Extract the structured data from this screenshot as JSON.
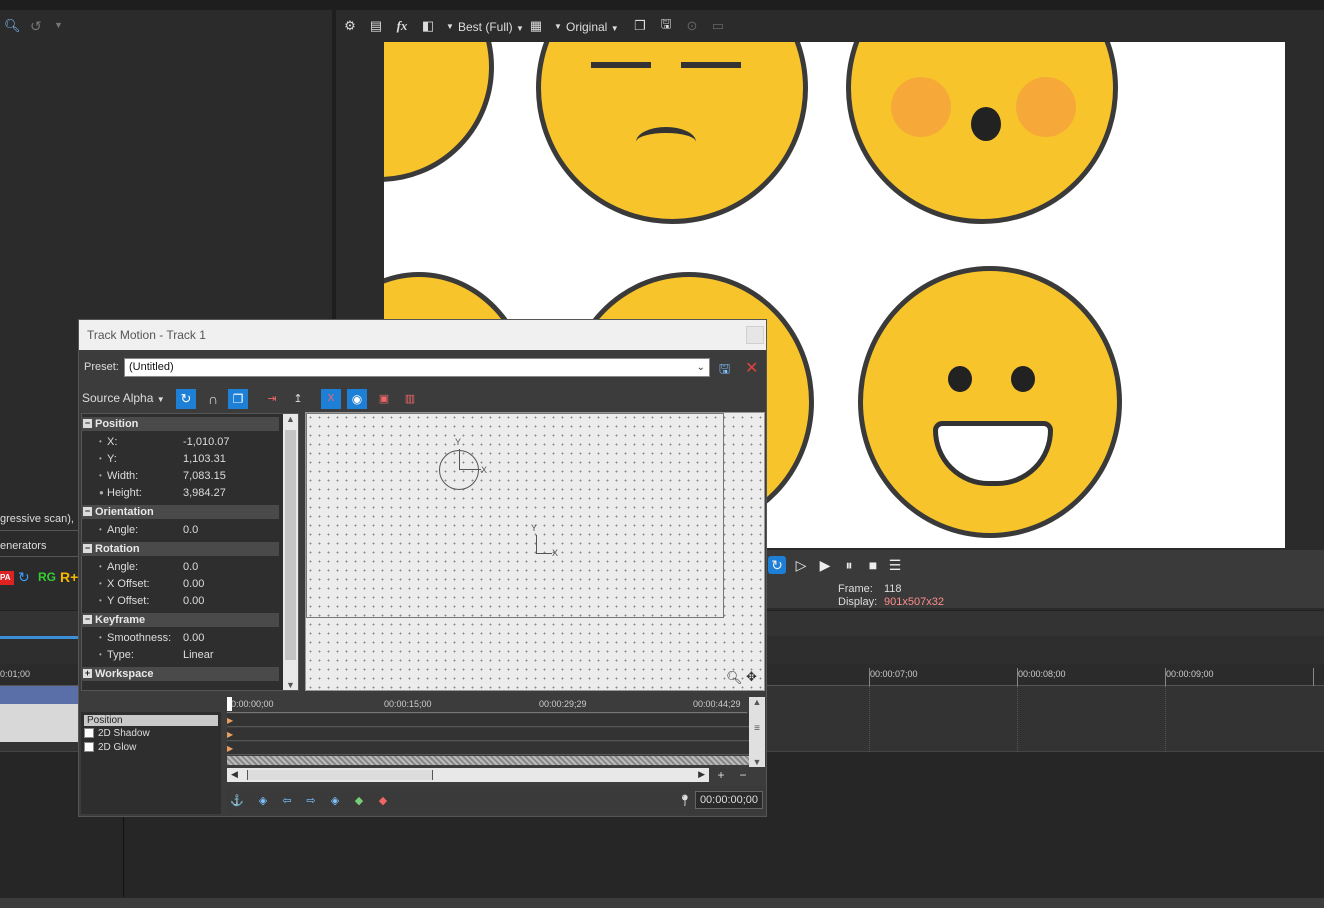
{
  "toolbar": {
    "quality": "Best (Full)",
    "size_mode": "Original"
  },
  "left_panel": {
    "media_info": "gressive scan),",
    "generators": "enerators",
    "ruler_time": "0:01;00"
  },
  "preview": {
    "frame_label": "Frame:",
    "frame_value": "118",
    "display_label": "Display:",
    "display_value": "901x507x32"
  },
  "timeline_ruler": [
    "00:00:07;00",
    "00:00:08;00",
    "00:00:09;00"
  ],
  "dialog": {
    "title": "Track Motion - Track 1",
    "preset_label": "Preset:",
    "preset_value": "(Untitled)",
    "source_alpha": "Source Alpha",
    "sections": {
      "position": {
        "label": "Position",
        "x_label": "X:",
        "x_value": "-1,010.07",
        "y_label": "Y:",
        "y_value": "1,103.31",
        "width_label": "Width:",
        "width_value": "7,083.15",
        "height_label": "Height:",
        "height_value": "3,984.27"
      },
      "orientation": {
        "label": "Orientation",
        "angle_label": "Angle:",
        "angle_value": "0.0"
      },
      "rotation": {
        "label": "Rotation",
        "angle_label": "Angle:",
        "angle_value": "0.0",
        "xoff_label": "X Offset:",
        "xoff_value": "0.00",
        "yoff_label": "Y Offset:",
        "yoff_value": "0.00"
      },
      "keyframe": {
        "label": "Keyframe",
        "smooth_label": "Smoothness:",
        "smooth_value": "0.00",
        "type_label": "Type:",
        "type_value": "Linear"
      },
      "workspace": {
        "label": "Workspace"
      }
    },
    "canvas": {
      "axis_y": "Y",
      "axis_x": "X"
    },
    "tracks": [
      "Position",
      "2D Shadow",
      "2D Glow"
    ],
    "kf_ruler": [
      "0:00:00;00",
      "00:00:15;00",
      "00:00:29;29",
      "00:00:44;29"
    ],
    "timecode": "00:00:00;00"
  }
}
